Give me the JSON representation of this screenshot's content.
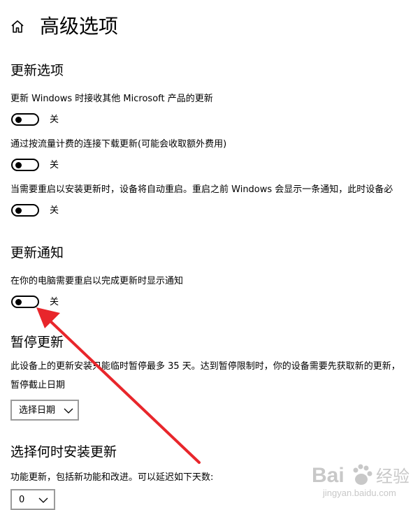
{
  "page": {
    "title": "高级选项"
  },
  "sections": {
    "update_options": {
      "title": "更新选项",
      "settings": [
        {
          "label": "更新 Windows 时接收其他 Microsoft 产品的更新",
          "state": "关"
        },
        {
          "label": "通过按流量计费的连接下载更新(可能会收取额外费用)",
          "state": "关"
        },
        {
          "label": "当需要重启以安装更新时，设备将自动重启。重启之前 Windows 会显示一条通知，此时设备必",
          "state": "关"
        }
      ]
    },
    "update_notifications": {
      "title": "更新通知",
      "settings": [
        {
          "label": "在你的电脑需要重启以完成更新时显示通知",
          "state": "关"
        }
      ]
    },
    "pause_updates": {
      "title": "暂停更新",
      "description": "此设备上的更新安装只能临时暂停最多 35 天。达到暂停限制时，你的设备需要先获取新的更新，",
      "until_label": "暂停截止日期",
      "date_select": "选择日期"
    },
    "install_time": {
      "title": "选择何时安装更新",
      "feature_label": "功能更新，包括新功能和改进。可以延迟如下天数:",
      "days_select": "0"
    }
  },
  "watermark": {
    "brand": "Bai",
    "brand_tail": "经验",
    "sub": "jingyan.baidu.com"
  },
  "colors": {
    "text": "#000000",
    "annotation_arrow": "#e8262b",
    "select_border": "#9a9a9a",
    "watermark": "#c8c8c8"
  }
}
